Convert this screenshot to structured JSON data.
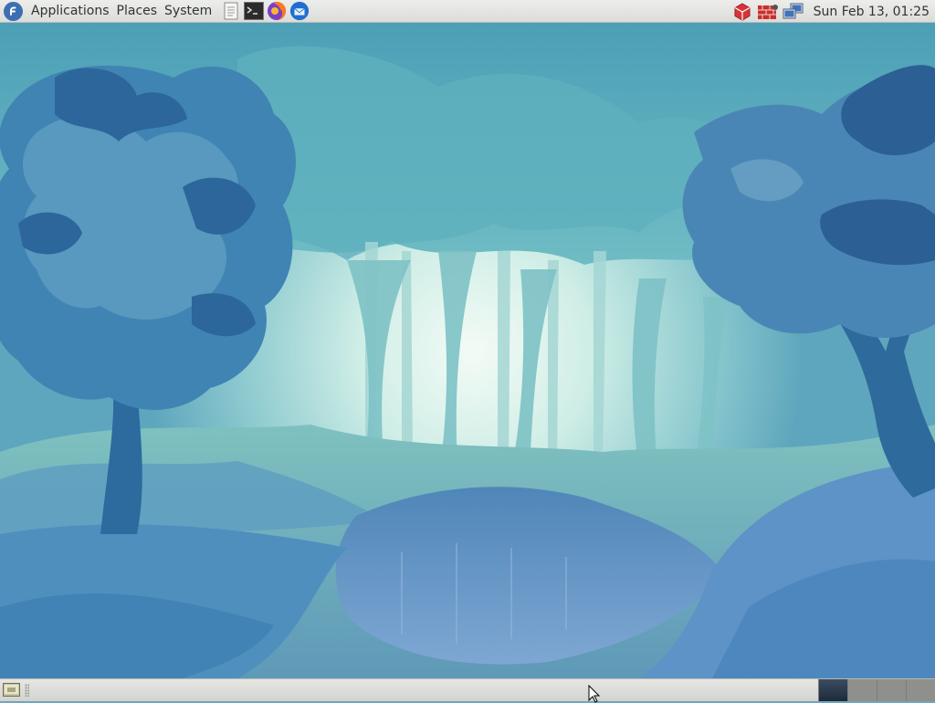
{
  "top_panel": {
    "menus": [
      "Applications",
      "Places",
      "System"
    ],
    "launchers": [
      "text-editor-icon",
      "terminal-icon",
      "firefox-icon",
      "thunderbird-icon"
    ],
    "tray": [
      "software-update-icon",
      "firewall-icon",
      "network-icon"
    ],
    "clock": "Sun Feb 13, 01:25"
  },
  "bottom_panel": {
    "show_desktop": "show-desktop-icon",
    "workspaces": [
      {
        "active": true
      },
      {
        "active": false
      },
      {
        "active": false
      },
      {
        "active": false
      }
    ]
  },
  "colors": {
    "fedora_blue": "#3c6eb4",
    "panel": "#e3e3e0",
    "sky": "#eaf6f0",
    "tree_dark": "#2d6a9e",
    "water": "#5e8fc4"
  }
}
